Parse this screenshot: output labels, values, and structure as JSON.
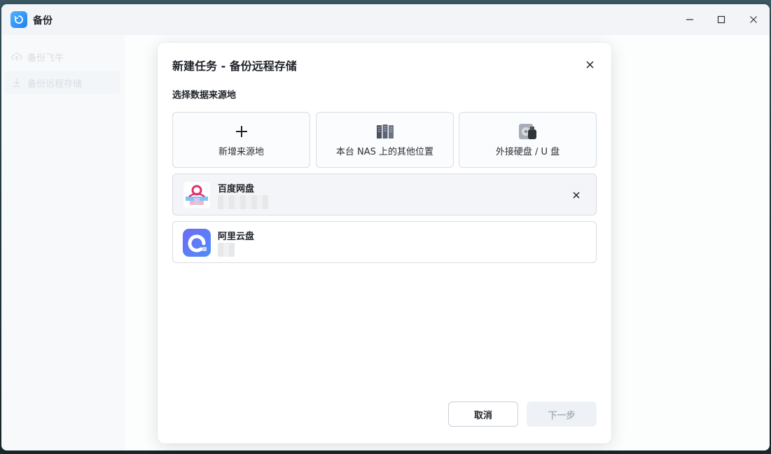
{
  "window": {
    "title": "备份",
    "controls": [
      "minimize",
      "maximize",
      "close"
    ]
  },
  "sidebar": {
    "items": [
      {
        "label": "备份飞牛",
        "icon": "cloud-upload-icon"
      },
      {
        "label": "备份远程存储",
        "icon": "download-icon"
      }
    ]
  },
  "dialog": {
    "title": "新建任务 - 备份远程存储",
    "section_label": "选择数据来源地",
    "options": [
      {
        "label": "新增来源地",
        "icon": "plus-icon"
      },
      {
        "label": "本台 NAS 上的其他位置",
        "icon": "nas-server-icon"
      },
      {
        "label": "外接硬盘 / U 盘",
        "icon": "external-drive-icon"
      }
    ],
    "sources": [
      {
        "name": "百度网盘",
        "icon": "baidu-netdisk-icon",
        "selected": true
      },
      {
        "name": "阿里云盘",
        "icon": "aliyun-drive-icon",
        "selected": false
      }
    ],
    "cancel_label": "取消",
    "next_label": "下一步"
  },
  "colors": {
    "accent": "#1f7ff0",
    "primary_text": "#1f2329",
    "border": "#d9dde3",
    "disabled_text": "#a9b1bd"
  }
}
